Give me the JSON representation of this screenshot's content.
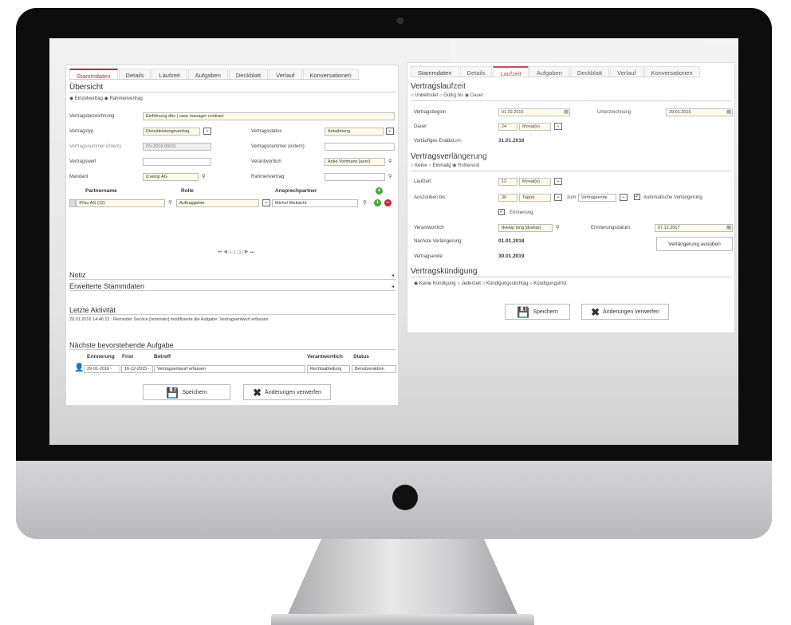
{
  "left": {
    "tabs": [
      "Stammdaten",
      "Details",
      "Laufzeit",
      "Aufgaben",
      "Deckblatt",
      "Verlauf",
      "Konversationen"
    ],
    "overview_title": "Übersicht",
    "contract_radio": {
      "a": "Einzelvertrag",
      "b": "Rahmenvertrag"
    },
    "labels": {
      "vertragsbezeichnung": "Vertragsbezeichnung",
      "vertragstyp": "Vertragstyp",
      "vertragsstatus": "Vertragsstatus",
      "nummer_intern": "Vertragsnummer (intern)",
      "nummer_extern": "Vertragsnummer (extern)",
      "vertragswert": "Vertragswert",
      "verantwortlich": "Verantwortlich",
      "mandant": "Mandant",
      "rahmenvertrag": "Rahmenvertrag"
    },
    "values": {
      "vertragsbezeichnung": "Einführung dbs | case manager contract",
      "vertragstyp": "Dienstleistungsvertrag",
      "vertragsstatus": "Anbahnung",
      "nummer_intern": "DV-2016-00011",
      "verantwortlich": "Anke Vortmann [avor]",
      "mandant": "d.velop AG"
    },
    "partner_headers": {
      "partnername": "Partnername",
      "rolle": "Rolle",
      "ansprechpartner": "Ansprechpartner"
    },
    "partner_row": {
      "name": "4You AG (12)",
      "rolle": "Auftraggeber",
      "ansprechpartner": "Michel Weitsicht"
    },
    "pagination": "⏮ ◀ 1-1 (1) ▶ ⏭",
    "notiz": "Notiz",
    "erweiterte": "Erweiterte Stammdaten",
    "aktivitaet_title": "Letzte Aktivität",
    "aktivitaet_text": "29.01.2016 14:46:12 : Reminder Service [reminder] modifizierte die Aufgabe: Vertragsentwurf erfassen",
    "aufgabe_title": "Nächste bevorstehende Aufgabe",
    "task_headers": {
      "erinnerung": "Erinnerung",
      "frist": "Frist",
      "betreff": "Betreff",
      "verantwortlich": "Verantwortlich",
      "status": "Status"
    },
    "task_row": {
      "erinnerung": "29-01-2016 -",
      "frist": "16-12-2015 -",
      "betreff": "Vertragsentwurf erfassen",
      "verantwortlich": "Rechtsabteilung",
      "status": "Benutzeraktion"
    },
    "save": "Speichern",
    "discard": "Änderungen verwerfen"
  },
  "right": {
    "tabs": [
      "Stammdaten",
      "Details",
      "Laufzeit",
      "Aufgaben",
      "Deckblatt",
      "Verlauf",
      "Konversationen"
    ],
    "laufzeit_title": "Vertragslaufzeit",
    "laufzeit_radio": {
      "a": "Unbefristet",
      "b": "Gültig bis",
      "c": "Dauer"
    },
    "labels": {
      "vertragsbeginn": "Vertragsbeginn",
      "unterzeichnung": "Unterzeichnung",
      "dauer": "Dauer",
      "enddatum": "Vorläufiges Enddatum:",
      "laufzeit": "Laufzeit:",
      "auszuueben": "Auszuüben bis:",
      "zum": "zum",
      "verantwortlich": "Verantwortlich",
      "erinnerungsdatum": "Erinnerungsdatum",
      "naechste": "Nächste Verlängerung:",
      "vertragsende": "Vertragsende:"
    },
    "values": {
      "vertragsbeginn": "01.02.2016",
      "unterzeichnung": "29.01.2016",
      "dauer_num": "24",
      "dauer_unit": "Monat(e)",
      "enddatum": "31.01.2018",
      "laufzeit_num": "12",
      "laufzeit_unit": "Monat(e)",
      "ausueben_num": "30",
      "ausueben_unit": "Tag(e)",
      "ausueben_ref": "Vertragsende",
      "verantwortlich": "dvelop long [dvelop]",
      "erinnerungsdatum": "07.12.2017",
      "naechste": "01.01.2018",
      "vertragsende": "30.01.2019"
    },
    "verl_title": "Vertragsverlängerung",
    "verl_radio": {
      "a": "Keine",
      "b": "Einmalig",
      "c": "Rollierend"
    },
    "auto_verl": "Automatische Verlängerung",
    "erinnerung": "Erinnerung",
    "verl_button": "Verlängerung ausüben",
    "kuend_title": "Vertragskündigung",
    "kuend_radio": {
      "a": "Keine Kündigung",
      "b": "Jederzeit",
      "c": "Kündigungsstichtag",
      "d": "Kündigungsfrist"
    },
    "save": "Speichern",
    "discard": "Änderungen verwerfen"
  },
  "colors": {
    "accent": "#c62839",
    "field_highlight": "#fffbe6",
    "add": "#3aaa35",
    "remove": "#d0202a"
  }
}
